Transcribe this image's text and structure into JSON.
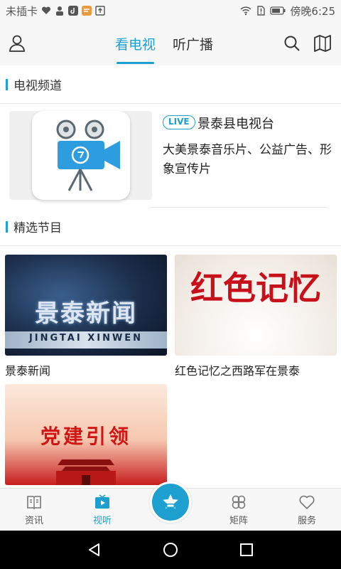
{
  "status_bar": {
    "carrier": "未插卡",
    "time": "傍晚6:25"
  },
  "header": {
    "tabs": [
      {
        "label": "看电视",
        "active": true
      },
      {
        "label": "听广播",
        "active": false
      }
    ],
    "icons": [
      "user-icon",
      "search-icon",
      "map-icon"
    ]
  },
  "tv_section": {
    "title": "电视频道",
    "channel": {
      "live_badge": "LIVE",
      "name": "景泰县电视台",
      "description": "大美景泰音乐片、公益广告、形象宣传片"
    }
  },
  "programs_section": {
    "title": "精选节目",
    "items": [
      {
        "title": "景泰新闻",
        "image_text": "景泰新闻",
        "image_subtext": "JINGTAI XINWEN"
      },
      {
        "title": "红色记忆之西路军在景泰",
        "image_text": "红色记忆"
      },
      {
        "title": "",
        "image_text": "党建引领"
      }
    ]
  },
  "bottom_nav": {
    "items": [
      {
        "label": "资讯",
        "icon": "book-icon",
        "active": false
      },
      {
        "label": "视听",
        "icon": "tv-play-icon",
        "active": true
      },
      {
        "label": "",
        "icon": "star-icon",
        "active": false
      },
      {
        "label": "矩阵",
        "icon": "clover-icon",
        "active": false
      },
      {
        "label": "服务",
        "icon": "heart-icon",
        "active": false
      }
    ]
  },
  "colors": {
    "accent": "#1da0d0",
    "background": "#f4f4f4",
    "content": "#ffffff"
  }
}
